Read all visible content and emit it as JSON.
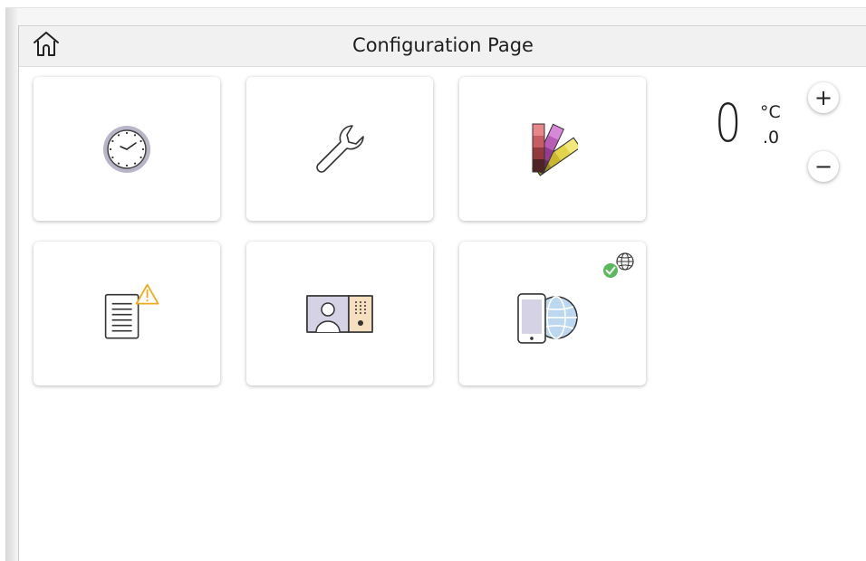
{
  "header": {
    "title": "Configuration Page",
    "home_icon": "home-icon"
  },
  "tiles": [
    {
      "name": "clock",
      "icon": "clock-icon"
    },
    {
      "name": "settings",
      "icon": "wrench-icon"
    },
    {
      "name": "color-palette",
      "icon": "color-swatches-icon"
    },
    {
      "name": "error-log",
      "icon": "document-warning-icon"
    },
    {
      "name": "intercom",
      "icon": "intercom-icon"
    },
    {
      "name": "remote-access",
      "icon": "phone-globe-icon",
      "badge": "globe-check-icon"
    }
  ],
  "temperature": {
    "integer": "0",
    "decimal": ".0",
    "unit": "°C"
  },
  "controls": {
    "increase_label": "+",
    "decrease_label": "−"
  },
  "colors": {
    "header_bg": "#f1f1f1",
    "warning": "#f0a81c",
    "check": "#5cb85c",
    "globe": "#bcd8f0"
  }
}
